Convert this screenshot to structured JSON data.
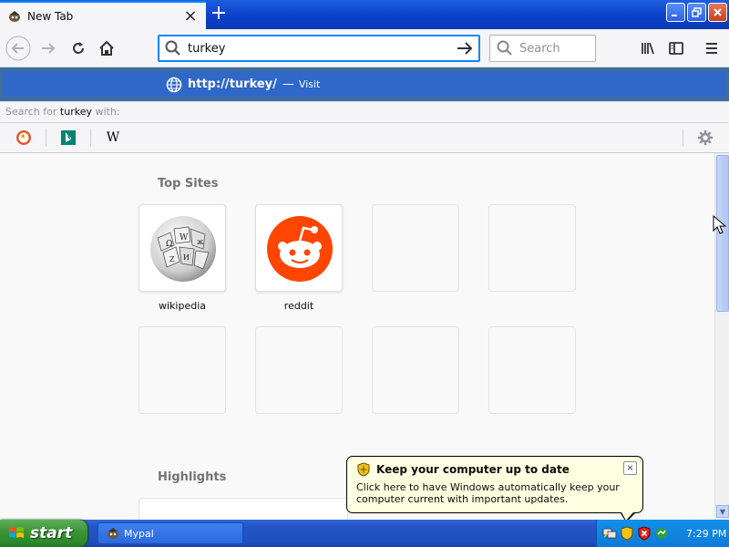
{
  "browser": {
    "tab": {
      "title": "New Tab",
      "favicon": "mypal-icon"
    },
    "new_tab_label": "+",
    "url_value": "turkey",
    "search_placeholder": "Search",
    "suggestion": {
      "url_prefix": "http://",
      "url_host": "turkey",
      "url_suffix": "/",
      "dash": "—",
      "action": "Visit"
    },
    "search_with": {
      "prefix": "Search for",
      "term": "turkey",
      "suffix": "with:"
    },
    "engines": [
      "duckduckgo-icon",
      "bing-icon",
      "wikipedia-icon"
    ],
    "engine_w": "W"
  },
  "newtab": {
    "top_sites_title": "Top Sites",
    "highlights_title": "Highlights",
    "top_sites": [
      {
        "label": "wikipedia",
        "icon": "wikipedia-globe-icon"
      },
      {
        "label": "reddit",
        "icon": "reddit-icon"
      },
      {
        "label": ""
      },
      {
        "label": ""
      },
      {
        "label": ""
      },
      {
        "label": ""
      },
      {
        "label": ""
      },
      {
        "label": ""
      }
    ]
  },
  "balloon": {
    "title": "Keep your computer up to date",
    "body": "Click here to have Windows automatically keep your computer current with important updates.",
    "close": "×"
  },
  "taskbar": {
    "start_label": "start",
    "window_label": "Mypal",
    "clock": "7:29 PM"
  },
  "colors": {
    "accent": "#0a84ff",
    "suggest_bg": "#2f68c8",
    "reddit": "#ff4500",
    "xp_blue": "#2456c9",
    "xp_green": "#3d963a"
  }
}
